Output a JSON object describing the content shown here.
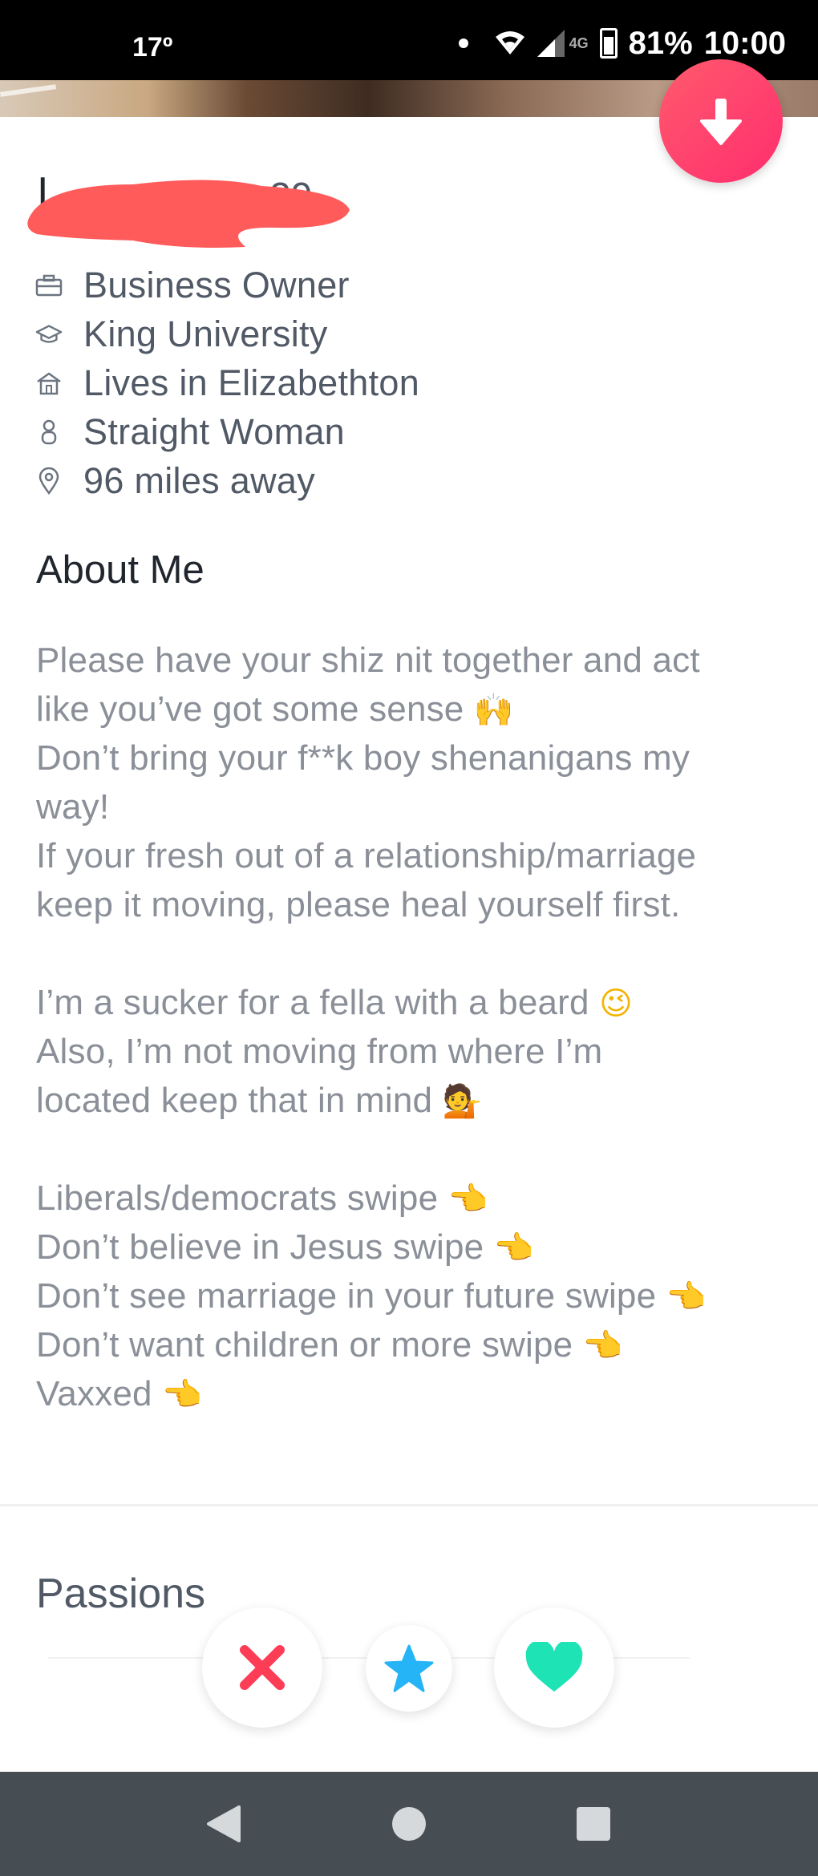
{
  "status_bar": {
    "temperature": "17º",
    "network": "4G",
    "battery": "81%",
    "time": "10:00"
  },
  "profile": {
    "name_visible": "I",
    "age_visible": "29",
    "details": [
      {
        "icon": "briefcase-icon",
        "text": "Business Owner"
      },
      {
        "icon": "graduation-cap-icon",
        "text": "King University"
      },
      {
        "icon": "home-icon",
        "text": "Lives in Elizabethton"
      },
      {
        "icon": "person-icon",
        "text": "Straight Woman"
      },
      {
        "icon": "location-pin-icon",
        "text": "96 miles away"
      }
    ]
  },
  "about": {
    "heading": "About Me",
    "lines": [
      "Please have your shiz nit together and act",
      "like you’ve got some sense",
      "Don’t bring your f**k boy shenanigans my",
      "way!",
      "If your fresh out of a relationship/marriage",
      "keep it moving, please heal yourself first.",
      "",
      "I’m a sucker for a fella with a beard",
      "Also, I’m not moving from where I’m",
      "located keep that in mind",
      "",
      "Liberals/democrats swipe",
      "Don’t believe in Jesus swipe",
      "Don’t see marriage in your future swipe",
      "Don’t want children or more swipe",
      "Vaxxed"
    ],
    "emojis": {
      "raised_hands": "🙌",
      "wink": "😉",
      "woman_tipping_hand": "💁",
      "pointing": "👈"
    }
  },
  "passions": {
    "heading": "Passions"
  },
  "colors": {
    "accent_gradient_start": "#ff5a6c",
    "accent_gradient_end": "#ff2d6f",
    "nope_red": "#fd3c56",
    "super_like_blue": "#25b4f6",
    "like_green": "#1ee3b5"
  }
}
